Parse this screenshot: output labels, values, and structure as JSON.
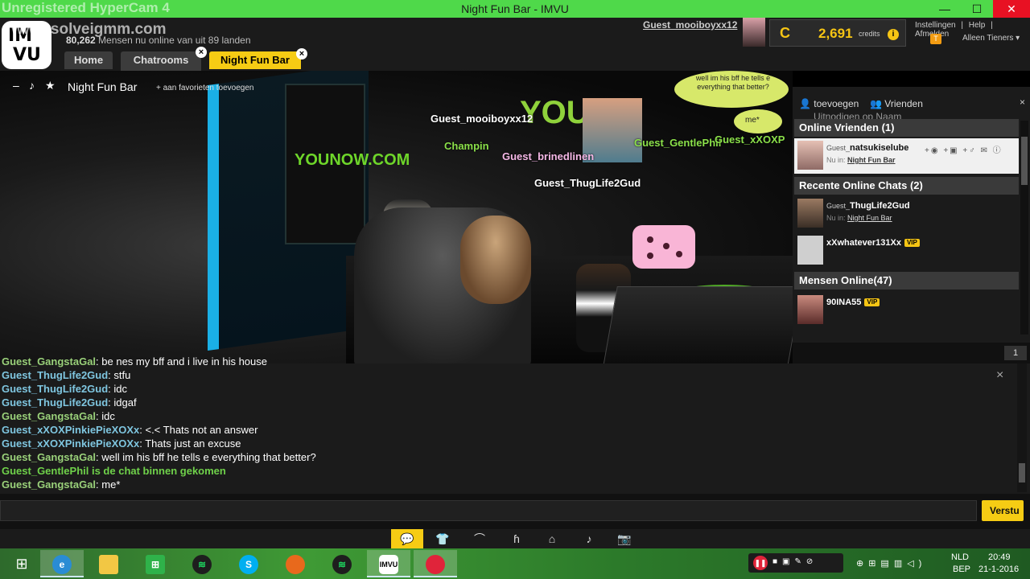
{
  "window": {
    "title": "Night Fun Bar - IMVU",
    "watermark": "Unregistered HyperCam 4",
    "min": "—",
    "max": "☐",
    "close": "✕"
  },
  "header": {
    "logo_top": "IM",
    "logo_bottom": "VU",
    "site_watermark": "www.solveigmm.com",
    "online_count": "80,262",
    "online_text": "Mensen nu online van uit 89 landen",
    "user_name": "Guest_mooiboyxx12",
    "credits_symbol": "C",
    "credits": "2,691",
    "credits_label": "credits",
    "credits_info": "i",
    "links": [
      "Instellingen",
      "|",
      "Help",
      "|",
      "Afmelden"
    ],
    "teen_badge": "T",
    "teen_label": "Alleen Tieners ▾",
    "tabs": [
      "Home",
      "Chatrooms",
      "Night Fun Bar"
    ],
    "tab_close": "×"
  },
  "scene": {
    "minus": "–",
    "note": "♪",
    "star": "★",
    "room_name": "Night Fun Bar",
    "fav": "+ aan favorieten toevoegen",
    "you_logo": "YOU",
    "you_now": "YOUNOW.COM",
    "bubble1": "well im his bff he tells e everything that better?",
    "bubble2": "me*",
    "names": {
      "mooiboy": "Guest_mooiboyxx12",
      "champin": "Champin",
      "brinedlinen": "Guest_brinedlinen",
      "thuglife": "Guest_ThugLife2Gud",
      "gentle": "Guest_GentlePhil",
      "xoxo": "Guest_xXOXP",
      "gangsta": "Guest_GangstaGal"
    }
  },
  "friends": {
    "add": "toevoegen",
    "friends": "Vrienden",
    "invite": "Uitnodigen op Naam",
    "close": "×",
    "online_header": "Online Vrienden (1)",
    "online": {
      "prefix": "Guest_",
      "name": "natsukiselube",
      "nu_in": "Nu in:",
      "room": "Night Fun Bar",
      "actions": "+◉ +▣ +♂ ✉ ⓘ"
    },
    "recent_header": "Recente Online Chats (2)",
    "recent": [
      {
        "prefix": "Guest_",
        "name": "ThugLife2Gud",
        "nu_in": "Nu in:",
        "room": "Night Fun Bar"
      },
      {
        "name": "xXwhatever131Xx",
        "badge": "VIP"
      }
    ],
    "people_header": "Mensen Online(47)",
    "people": [
      {
        "name": "90INA55",
        "badge": "VIP"
      }
    ],
    "people_count": "1"
  },
  "chat": {
    "close": "×",
    "lines": [
      {
        "who": "Guest_GangstaGal",
        "text": ": be nes my bff and i live in his house",
        "color": "#9ad17a"
      },
      {
        "who": "Guest_ThugLife2Gud",
        "text": ": stfu",
        "color": "#7fc6e0"
      },
      {
        "who": "Guest_ThugLife2Gud",
        "text": ": idc",
        "color": "#7fc6e0"
      },
      {
        "who": "Guest_ThugLife2Gud",
        "text": ": idgaf",
        "color": "#7fc6e0"
      },
      {
        "who": "Guest_GangstaGal",
        "text": ": idc",
        "color": "#9ad17a"
      },
      {
        "who": "Guest_xXOXPinkiePieXOXx",
        "text": ": <.< Thats not an answer",
        "color": "#7fc6e0"
      },
      {
        "who": "Guest_xXOXPinkiePieXOXx",
        "text": ": Thats just an excuse",
        "color": "#7fc6e0"
      },
      {
        "who": "Guest_GangstaGal",
        "text": ": well im his bff he tells e everything that better?",
        "color": "#9ad17a"
      },
      {
        "who": "Guest_GentlePhil is de chat binnen gekomen",
        "text": "",
        "color": "#6fd14a"
      },
      {
        "who": "Guest_GangstaGal",
        "text": ": me*",
        "color": "#9ad17a"
      }
    ],
    "input_value": "",
    "send": "Verstu"
  },
  "toolbar": {
    "icons": [
      "💬",
      "👕",
      "⌂",
      "♪",
      "📷",
      "✦",
      "⚑"
    ]
  },
  "taskbar": {
    "start": "⊞",
    "lang": "NLD",
    "lang2": "BEP",
    "time": "20:49",
    "date": "21-1-2016"
  }
}
